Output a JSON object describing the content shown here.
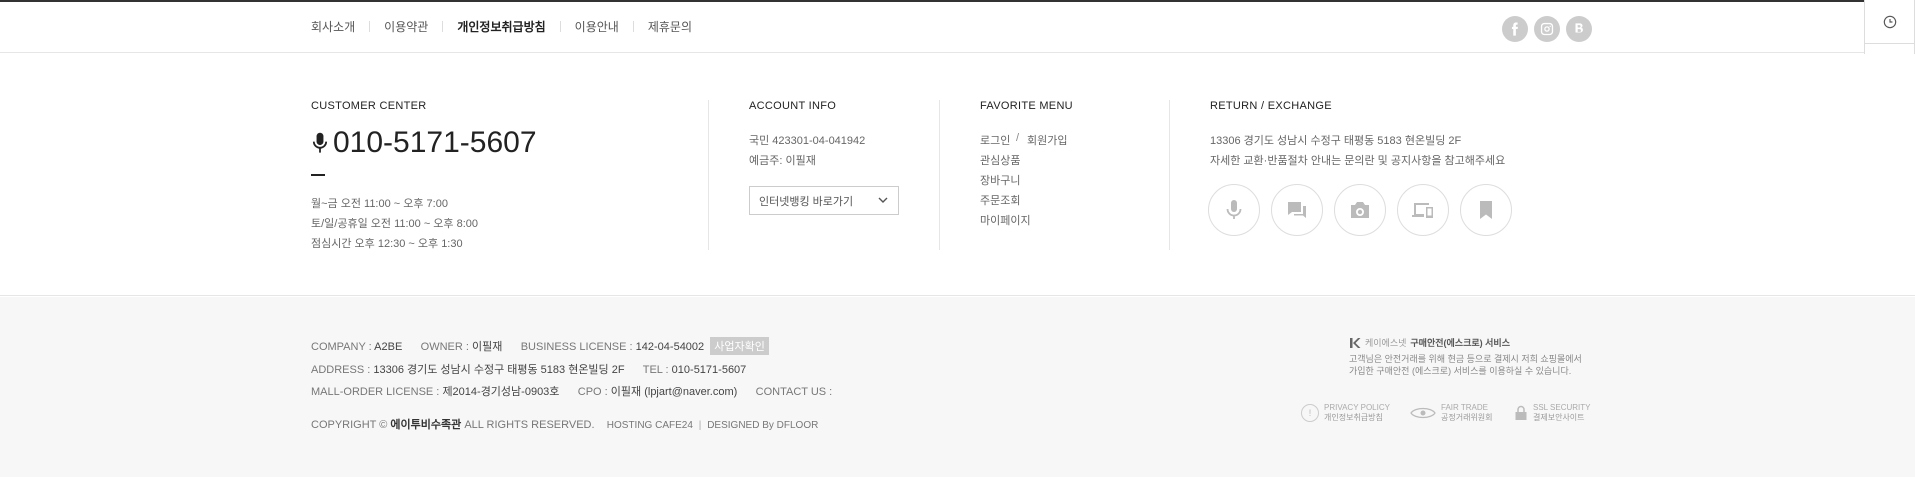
{
  "top_nav": {
    "links": [
      "회사소개",
      "이용약관",
      "개인정보취급방침",
      "이용안내",
      "제휴문의"
    ],
    "active_index": 2
  },
  "social_icons": [
    "facebook-icon",
    "instagram-icon",
    "blog-icon"
  ],
  "side_widget": [
    "clock-icon",
    "chevron-up-icon",
    "chevron-down-icon"
  ],
  "customer_center": {
    "title": "CUSTOMER CENTER",
    "phone": "010-5171-5607",
    "hours": [
      "월~금 오전 11:00 ~ 오후 7:00",
      "토/일/공휴일 오전 11:00 ~ 오후 8:00",
      "점심시간 오후 12:30 ~ 오후 1:30"
    ]
  },
  "account_info": {
    "title": "ACCOUNT INFO",
    "account": "국민 423301-04-041942",
    "holder": "예금주: 이필재",
    "select_label": "인터넷뱅킹 바로가기"
  },
  "favorite_menu": {
    "title": "FAVORITE MENU",
    "login": "로그인",
    "slash": "/",
    "join": "회원가입",
    "items": [
      "관심상품",
      "장바구니",
      "주문조회",
      "마이페이지"
    ]
  },
  "return_exchange": {
    "title": "RETURN / EXCHANGE",
    "address": "13306 경기도 성남시 수정구 태평동 5183 현온빌딩 2F",
    "note": "자세한 교환·반품절차 안내는 문의란 및 공지사항을 참고해주세요",
    "icons": [
      "microphone-icon",
      "chat-icon",
      "camera-icon",
      "devices-icon",
      "bookmark-icon"
    ]
  },
  "footer": {
    "company_label": "COMPANY :",
    "company": "A2BE",
    "owner_label": "OWNER :",
    "owner": "이필재",
    "license_label": "BUSINESS LICENSE :",
    "license": "142-04-54002",
    "license_badge": "사업자확인",
    "address_label": "ADDRESS :",
    "address": "13306 경기도 성남시 수정구 태평동 5183 현온빌딩 2F",
    "tel_label": "TEL :",
    "tel": "010-5171-5607",
    "mall_label": "MALL-ORDER LICENSE :",
    "mall": "제2014-경기성남-0903호",
    "cpo_label": "CPO :",
    "cpo": "이필재 (lpjart@naver.com)",
    "contact_label": "CONTACT US :",
    "copyright_prefix": "COPYRIGHT ©",
    "copyright_name": "에이투비수족관",
    "copyright_suffix": "ALL RIGHTS RESERVED.",
    "hosting": "HOSTING CAFE24",
    "designed": "DESIGNED By DFLOOR"
  },
  "escrow": {
    "brand": "케이에스넷",
    "title": "구매안전(에스크로) 서비스",
    "desc": "고객님은 안전거래를 위해 현금 등으로 결제시 저희 쇼핑몰에서 가입한 구매안전 (에스크로) 서비스를 이용하실 수 있습니다."
  },
  "certs": [
    {
      "title": "PRIVACY POLICY",
      "sub": "개인정보취급방침"
    },
    {
      "title": "FAIR TRADE",
      "sub": "공정거래위원회"
    },
    {
      "title": "SSL SECURITY",
      "sub": "결제보안사이트"
    }
  ]
}
